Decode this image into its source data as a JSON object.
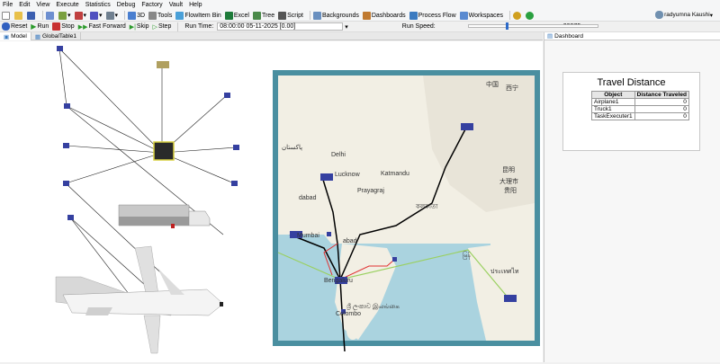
{
  "menu": [
    "File",
    "Edit",
    "View",
    "Execute",
    "Statistics",
    "Debug",
    "Factory",
    "Vault",
    "Help"
  ],
  "toolbar": {
    "view3d": "3D",
    "tools": "Tools",
    "flowitem_bin": "FlowItem Bin",
    "excel": "Excel",
    "tree": "Tree",
    "script": "Script",
    "backgrounds": "Backgrounds",
    "dashboards": "Dashboards",
    "process_flow": "Process Flow",
    "workspaces": "Workspaces"
  },
  "user": {
    "name": "radyumna Kaushi"
  },
  "run_controls": {
    "reset": "Reset",
    "run": "Run",
    "stop": "Stop",
    "fast_forward": "Fast Forward",
    "skip": "Skip",
    "step": "Step",
    "run_time_label": "Run Time:",
    "run_time_value": "08:00:00  05-11-2025  [0.00]",
    "run_speed_label": "Run Speed:",
    "run_speed_value": "29975"
  },
  "tabs": {
    "model": "Model",
    "global_table": "GlobalTable1",
    "dashboard": "Dashboard"
  },
  "map_labels": {
    "china_cn": "中国",
    "xining": "西宁",
    "pakistan": "پاکستان",
    "delhi": "Delhi",
    "lucknow": "Lucknow",
    "kathmandu": "Katmandu",
    "prayagraj": "Prayagraj",
    "ahmedabad": "dabad",
    "mumbai": "Mumbai",
    "hyderabad": "abad",
    "bengaluru": "Bengaluru",
    "sri_lanka": "ශ්‍රී ලංකාව\nஇலங்கை",
    "myanmar": "မြန်",
    "thailand": "ประเทศไท",
    "kunming": "昆明",
    "dali": "大理市",
    "guiyang": "贵阳",
    "colombo": "Colombo",
    "kolkata": "কলকাতা"
  },
  "dashboard": {
    "title": "Travel Distance",
    "headers": [
      "Object",
      "Distance Traveled"
    ],
    "rows": [
      {
        "object": "Airplane1",
        "distance": "0"
      },
      {
        "object": "Truck1",
        "distance": "0"
      },
      {
        "object": "TaskExecuter1",
        "distance": "0"
      }
    ]
  }
}
